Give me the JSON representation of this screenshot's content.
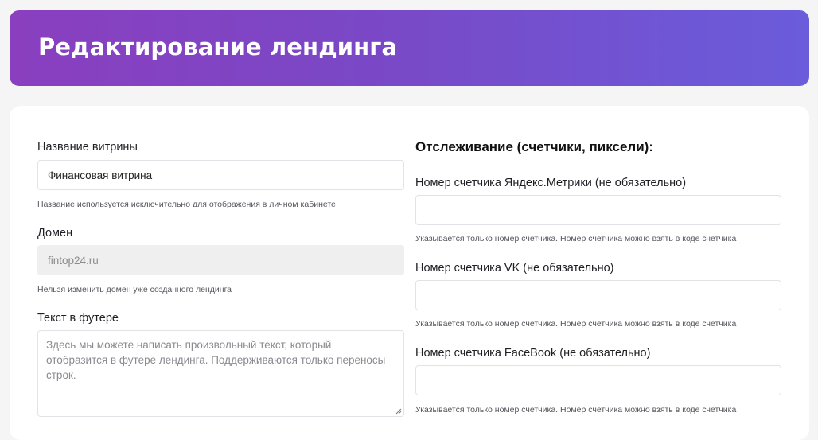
{
  "header": {
    "title": "Редактирование лендинга"
  },
  "form": {
    "name": {
      "label": "Название витрины",
      "value": "Финансовая витрина",
      "hint": "Название используется исключительно для отображения в личном кабинете"
    },
    "domain": {
      "label": "Домен",
      "value": "fintop24.ru",
      "hint": "Нельзя изменить домен уже созданного лендинга"
    },
    "footer_text": {
      "label": "Текст в футере",
      "placeholder": "Здесь мы можете написать произвольный текст, который отобразится в футере лендинга. Поддерживаются только переносы строк.",
      "value": ""
    }
  },
  "tracking": {
    "title": "Отслеживание (счетчики, пиксели):",
    "yandex": {
      "label": "Номер счетчика Яндекс.Метрики (не обязательно)",
      "value": "",
      "hint": "Указывается только номер счетчика. Номер счетчика можно взять в коде счетчика"
    },
    "vk": {
      "label": "Номер счетчика VK (не обязательно)",
      "value": "",
      "hint": "Указывается только номер счетчика. Номер счетчика можно взять в коде счетчика"
    },
    "facebook": {
      "label": "Номер счетчика FaceBook (не обязательно)",
      "value": "",
      "hint": "Указывается только номер счетчика. Номер счетчика можно взять в коде счетчика"
    }
  }
}
